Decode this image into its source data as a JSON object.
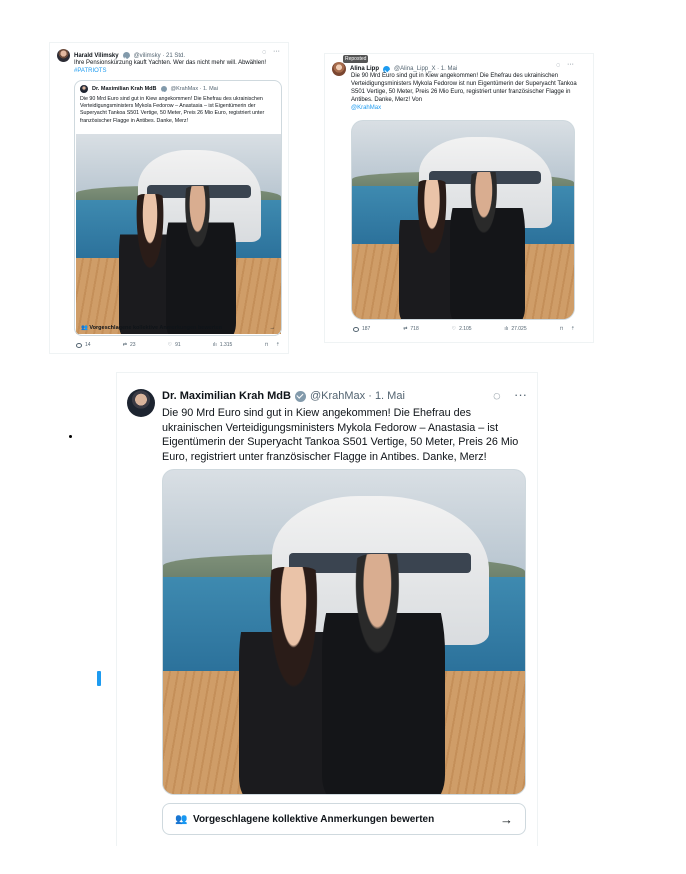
{
  "tweet_small_left": {
    "author_name": "Harald Vilimsky",
    "handle_time": "@vilimsky · 21 Std.",
    "text": "Ihre Pensionskürzung kauft Yachten. Wer das nicht mehr will. Abwählen!",
    "hashtag": "#PATRIOTS",
    "quote_author": "Dr. Maximilian Krah MdB",
    "quote_handle_time": "@KrahMax · 1. Mai",
    "quote_text": "Die 90 Mrd Euro sind gut in Kiew angekommen! Die Ehefrau des ukrainischen Verteidigungsministers Mykola Fedorow – Anastasia – ist Eigentümerin der Superyacht Tankoa S501 Vertige, 50 Meter, Preis 26 Mio Euro, registriert unter französischer Flagge in Antibes. Danke, Merz!",
    "note_label": "Vorgeschlagene kollektive Anmerkungen bewerten",
    "actions": {
      "replies": "14",
      "reposts": "23",
      "likes": "91",
      "views": "1.315"
    }
  },
  "tweet_small_right": {
    "tooltip": "Reposted",
    "author_name": "Alina Lipp",
    "handle_time": "@Alina_Lipp_X · 1. Mai",
    "text": "Die 90 Mrd Euro sind gut in Kiew angekommen! Die Ehefrau des ukrainischen Verteidigungsministers Mykola Fedorow ist nun Eigentümerin der Superyacht Tankoa S501 Vertige, 50 Meter, Preis 26 Mio Euro, registriert unter französischer Flagge in Antibes. Danke, Merz! Von",
    "mention": "@KrahMax",
    "actions": {
      "replies": "187",
      "reposts": "718",
      "likes": "2.105",
      "views": "27.025"
    }
  },
  "tweet_large": {
    "author_name": "Dr. Maximilian Krah MdB",
    "handle_time": "@KrahMax · 1. Mai",
    "text": "Die 90 Mrd Euro sind gut in Kiew angekommen! Die Ehefrau des ukrainischen Verteidigungsministers Mykola Fedorow – Anastasia – ist Eigentümerin der Superyacht Tankoa S501 Vertige, 50 Meter, Preis 26 Mio Euro, registriert unter französischer Flagge in Antibes. Danke, Merz!",
    "note_label": "Vorgeschlagene kollektive Anmerkungen bewerten",
    "arrow": "→",
    "more": "···"
  },
  "colors": {
    "accent": "#1d9bf0",
    "muted": "#536471",
    "border": "#cfd9de"
  }
}
